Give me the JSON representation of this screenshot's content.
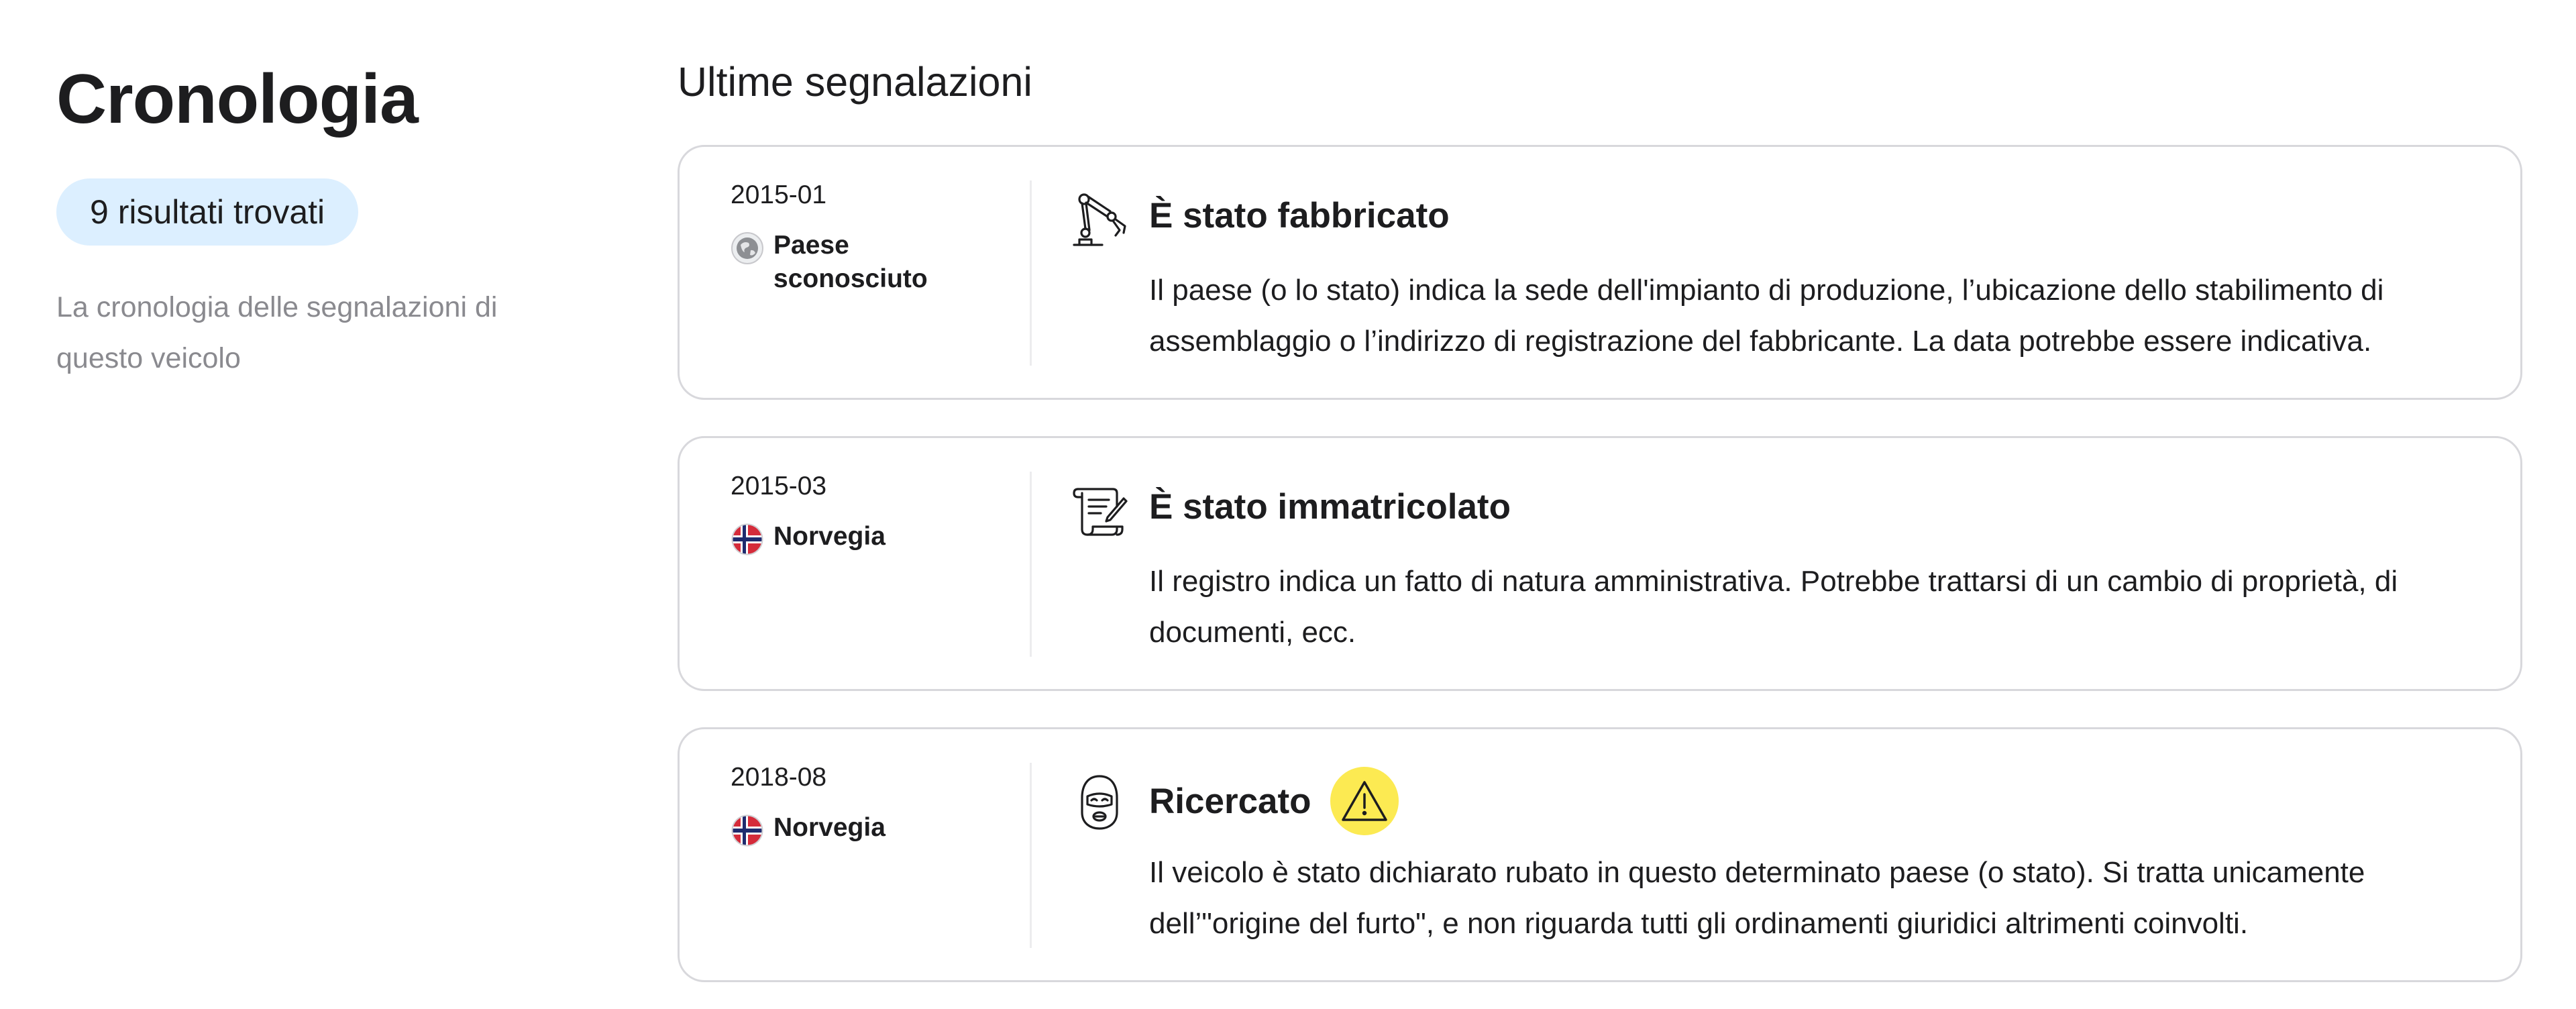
{
  "sidebar": {
    "title": "Cronologia",
    "badge": "9 risultati trovati",
    "description": "La cronologia delle segnalazioni di questo veicolo"
  },
  "main": {
    "heading": "Ultime segnalazioni",
    "events": [
      {
        "date": "2015-01",
        "country": "Paese sconosciuto",
        "country_icon": "globe-icon",
        "event_icon": "robotic-arm-icon",
        "title": "È stato fabbricato",
        "description": "Il paese (o lo stato) indica la sede dell'impianto di produzione, l’ubicazione dello stabilimento di assemblaggio o l’indirizzo di registrazione del fabbricante. La data potrebbe essere indicativa."
      },
      {
        "date": "2015-03",
        "country": "Norvegia",
        "country_icon": "norway-flag-icon",
        "event_icon": "document-scroll-icon",
        "title": "È stato immatricolato",
        "description": "Il registro indica un fatto di natura amministrativa. Potrebbe trattarsi di un cambio di proprietà, di documenti, ecc."
      },
      {
        "date": "2018-08",
        "country": "Norvegia",
        "country_icon": "norway-flag-icon",
        "event_icon": "balaclava-thief-icon",
        "title": "Ricercato",
        "warning_icon": "warning-icon",
        "description": "Il veicolo è stato dichiarato rubato in questo determinato paese (o stato). Si tratta unicamente dell’\"origine del furto\", e non riguarda tutti gli ordinamenti giuridici altrimenti coinvolti."
      }
    ]
  },
  "colors": {
    "badge_bg": "#dcefff",
    "card_border": "#d8d8dc",
    "muted_text": "#8a8a8f",
    "warning": "#fcea52",
    "text": "#1d1d1f"
  }
}
